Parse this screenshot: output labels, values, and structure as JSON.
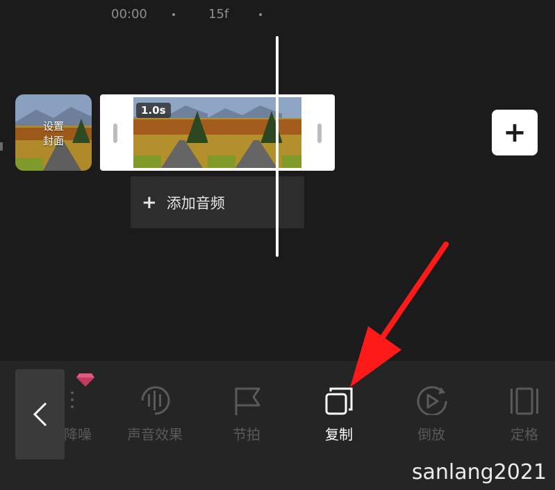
{
  "timeline": {
    "timecode_start": "00:00",
    "timecode_frame": "15f"
  },
  "cover": {
    "label_line1": "设置",
    "label_line2": "封面"
  },
  "clip": {
    "duration": "1.0s"
  },
  "add_audio": {
    "label": "添加音频",
    "icon": "plus-icon"
  },
  "add_clip": {
    "icon": "plus-icon"
  },
  "toolbar": {
    "back_icon": "chevron-left-icon",
    "items": [
      {
        "label": "降噪",
        "icon": "noise-reduce-icon",
        "premium": true
      },
      {
        "label": "声音效果",
        "icon": "sound-effect-icon"
      },
      {
        "label": "节拍",
        "icon": "flag-icon"
      },
      {
        "label": "复制",
        "icon": "copy-icon",
        "active": true
      },
      {
        "label": "倒放",
        "icon": "reverse-play-icon"
      },
      {
        "label": "定格",
        "icon": "freeze-frame-icon"
      }
    ]
  },
  "watermark": "sanlang2021",
  "colors": {
    "background": "#1b1b1c",
    "toolbar": "#252526",
    "arrow": "#ff1a1a",
    "premium": "#d4456b"
  }
}
